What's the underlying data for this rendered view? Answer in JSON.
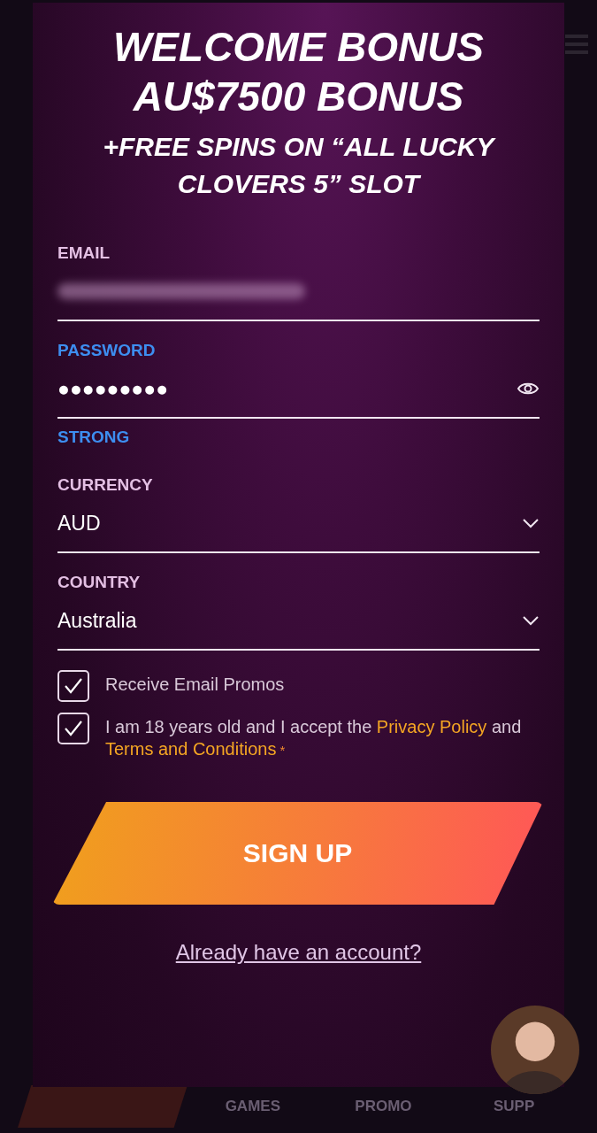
{
  "background_page": {
    "nav": [
      {
        "selected": true
      },
      {
        "label": "GAMES",
        "selected": false
      },
      {
        "label": "PROMO",
        "selected": false
      },
      {
        "label": "SUPP",
        "selected": false
      }
    ]
  },
  "signup": {
    "title_lines": [
      "WELCOME BONUS",
      "AU$7500 BONUS"
    ],
    "subtitle": "+FREE SPINS ON “ALL LUCKY CLOVERS 5” SLOT",
    "fields": [
      {
        "kind": "text",
        "label": "EMAIL",
        "focused": false,
        "blurred": true
      },
      {
        "kind": "password",
        "label": "PASSWORD",
        "value": "●●●●●●●●●",
        "focused": true,
        "strength": "STRONG"
      },
      {
        "kind": "select",
        "label": "CURRENCY",
        "value": "AUD",
        "focused": false
      },
      {
        "kind": "select",
        "label": "COUNTRY",
        "value": "Australia",
        "focused": false
      }
    ],
    "checkboxes": [
      {
        "checked": true,
        "parts": [
          {
            "text": "Receive Email Promos"
          }
        ]
      },
      {
        "checked": true,
        "parts": [
          {
            "text": "I am 18 years old and I accept the "
          },
          {
            "text": "Privacy Policy",
            "link": true
          },
          {
            "text": " and "
          },
          {
            "text": "Terms and Conditions",
            "link": true
          },
          {
            "text": " *",
            "required": true
          }
        ]
      }
    ],
    "submit": "SIGN UP",
    "login_link": "Already have an account?"
  }
}
